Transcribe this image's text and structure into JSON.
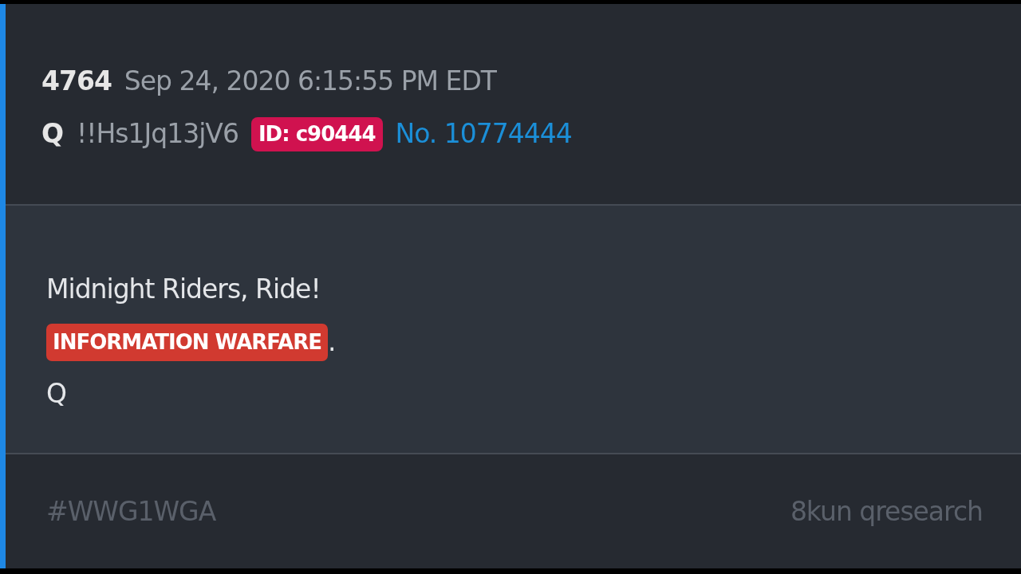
{
  "post": {
    "number": "4764",
    "timestamp": "Sep 24, 2020 6:15:55 PM EDT",
    "author": "Q",
    "tripcode": "!!Hs1Jq13jV6",
    "id_badge": "ID: c90444",
    "post_link": "No. 10774444"
  },
  "body": {
    "line_1": "Midnight Riders, Ride!",
    "highlight": "INFORMATION WARFARE",
    "highlight_suffix": ".",
    "signature": "Q"
  },
  "footer": {
    "hashtag": "#WWG1WGA",
    "source": "8kun qresearch"
  }
}
